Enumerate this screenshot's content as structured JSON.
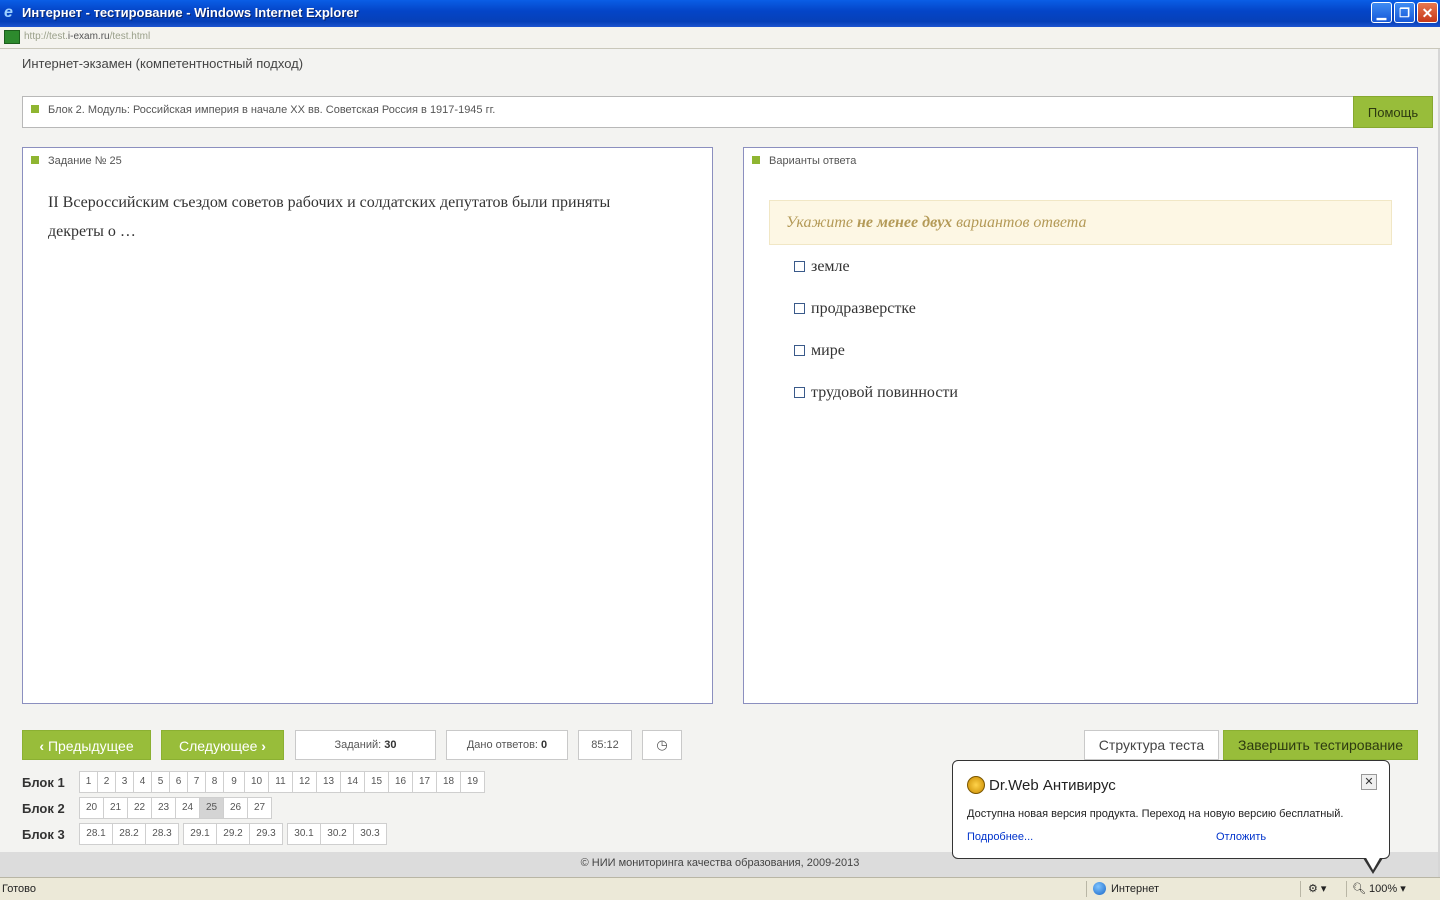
{
  "window": {
    "title": "Интернет - тестирование - Windows Internet Explorer",
    "min_label": "▁",
    "max_label": "❐",
    "close_label": "✕"
  },
  "address": {
    "prefix": "http://test.",
    "domain": "i-exam.ru",
    "path": "/test.html"
  },
  "app": {
    "title": "Интернет-экзамен (компетентностный подход)"
  },
  "block": {
    "label": "Блок 2. Модуль: Российская империя в начале XX вв. Советская Россия в 1917-1945 гг.",
    "help_label": "Помощь"
  },
  "task": {
    "title": "Задание № 25",
    "text": "II Всероссийским съездом советов рабочих и солдатских депутатов были приняты декреты о …"
  },
  "answers": {
    "title": "Варианты ответа",
    "hint_before": "Укажите ",
    "hint_bold": "не менее двух",
    "hint_after": " вариантов ответа",
    "options": [
      "земле",
      "продразверстке",
      "мире",
      "трудовой повинности"
    ]
  },
  "nav": {
    "prev_label": "Предыдущее",
    "next_label": "Следующее",
    "tasks_label": "Заданий: ",
    "tasks_count": "30",
    "answered_label": "Дано ответов: ",
    "answered_count": "0",
    "timer": "85:12",
    "structure_label": "Структура теста",
    "finish_label": "Завершить тестирование"
  },
  "blocks": [
    {
      "label": "Блок 1",
      "items": [
        "1",
        "2",
        "3",
        "4",
        "5",
        "6",
        "7",
        "8",
        "9",
        "10",
        "11",
        "12",
        "13",
        "14",
        "15",
        "16",
        "17",
        "18",
        "19"
      ]
    },
    {
      "label": "Блок 2",
      "items": [
        "20",
        "21",
        "22",
        "23",
        "24",
        "25",
        "26",
        "27"
      ]
    },
    {
      "label": "Блок 3",
      "items": [
        "28.1",
        "28.2",
        "28.3",
        "29.1",
        "29.2",
        "29.3",
        "30.1",
        "30.2",
        "30.3"
      ]
    }
  ],
  "active_task": "25",
  "footer": {
    "copyright": "© НИИ мониторинга качества образования, 2009-2013"
  },
  "drweb": {
    "title": "Dr.Web Антивирус",
    "message": "Доступна новая версия продукта. Переход на новую версию бесплатный.",
    "more_label": "Подробнее...",
    "postpone_label": "Отложить"
  },
  "status": {
    "ready": "Готово",
    "zone": "Интернет",
    "zoom": "100%"
  },
  "colors": {
    "accent_green": "#98bd3a",
    "panel_border": "#8b8fbf",
    "hint_text": "#b49a57"
  }
}
